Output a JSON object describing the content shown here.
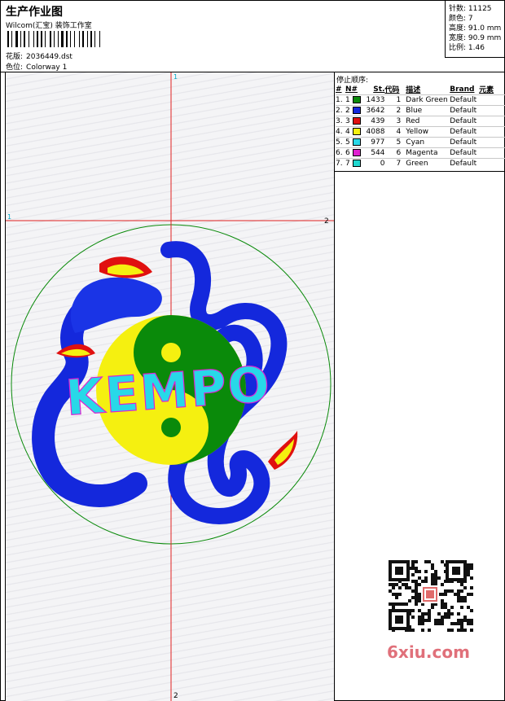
{
  "header": {
    "title": "生产作业图",
    "company": "Wilcom(汇宝) 装饰工作室",
    "pattern_label": "花版:",
    "pattern_value": "2036449.dst",
    "colorway_label": "色位:",
    "colorway_value": "Colorway 1"
  },
  "specs": {
    "stitches": "针数: 11125",
    "colors": "颜色: 7",
    "height": "高度: 91.0 mm",
    "width": "宽度: 90.9 mm",
    "ratio": "比例: 1.46"
  },
  "stop_order": {
    "title": "停止顺序:",
    "headers": [
      "#",
      "N#",
      "St.",
      "代码",
      "描述",
      "Brand",
      "元素"
    ],
    "rows": [
      {
        "idx": "1.",
        "n": "1",
        "st": "1433",
        "code": "1",
        "desc": "Dark Green",
        "brand": "Default",
        "color": "#0a8a0a"
      },
      {
        "idx": "2.",
        "n": "2",
        "st": "3642",
        "code": "2",
        "desc": "Blue",
        "brand": "Default",
        "color": "#1428dc"
      },
      {
        "idx": "3.",
        "n": "3",
        "st": "439",
        "code": "3",
        "desc": "Red",
        "brand": "Default",
        "color": "#e01010"
      },
      {
        "idx": "4.",
        "n": "4",
        "st": "4088",
        "code": "4",
        "desc": "Yellow",
        "brand": "Default",
        "color": "#f5f010"
      },
      {
        "idx": "5.",
        "n": "5",
        "st": "977",
        "code": "5",
        "desc": "Cyan",
        "brand": "Default",
        "color": "#28d8e8"
      },
      {
        "idx": "6.",
        "n": "6",
        "st": "544",
        "code": "6",
        "desc": "Magenta",
        "brand": "Default",
        "color": "#e020d0"
      },
      {
        "idx": "7.",
        "n": "7",
        "st": "0",
        "code": "7",
        "desc": "Green",
        "brand": "Default",
        "color": "#20d8d0"
      }
    ]
  },
  "design": {
    "text": "KEMPO",
    "marker_v_top": "1",
    "marker_v_bottom": "2",
    "marker_h_left": "1",
    "marker_h_right": "2"
  },
  "watermark": "6xiu.com"
}
